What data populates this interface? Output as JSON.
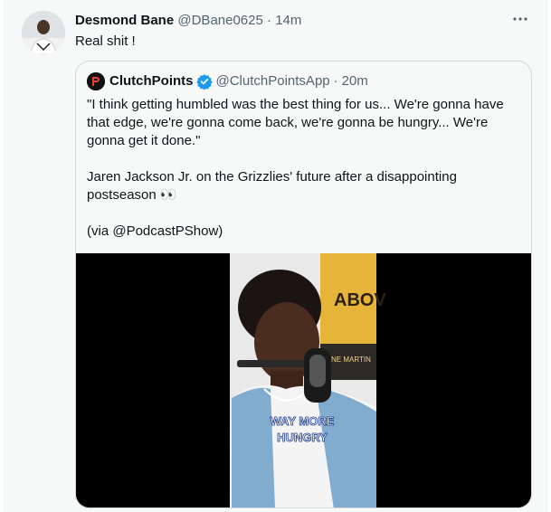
{
  "tweet": {
    "author_name": "Desmond Bane",
    "author_handle": "@DBane0625",
    "separator": "·",
    "time": "14m",
    "text": "Real shit !",
    "more_icon": "more-icon"
  },
  "quote": {
    "author_name": "ClutchPoints",
    "author_handle": "@ClutchPointsApp",
    "separator": "·",
    "time": "20m",
    "verified_color": "#1d9bf0",
    "paragraph_1": "\"I think getting humbled was the best thing for us... We're gonna have that edge, we're gonna come back, we're gonna be hungry... We're gonna get it done.\"",
    "paragraph_2": "Jaren Jackson Jr. on the Grizzlies' future after a disappointing postseason 👀",
    "paragraph_3": "(via @PodcastPShow)"
  },
  "media": {
    "caption": "WAY MORE HUNGRY",
    "poster_text": "ABOV",
    "poster_sub": "NE MARTIN"
  },
  "colors": {
    "background": "#f7f9f9",
    "text_primary": "#0f1419",
    "text_secondary": "#536471",
    "border": "#cfd9de"
  }
}
